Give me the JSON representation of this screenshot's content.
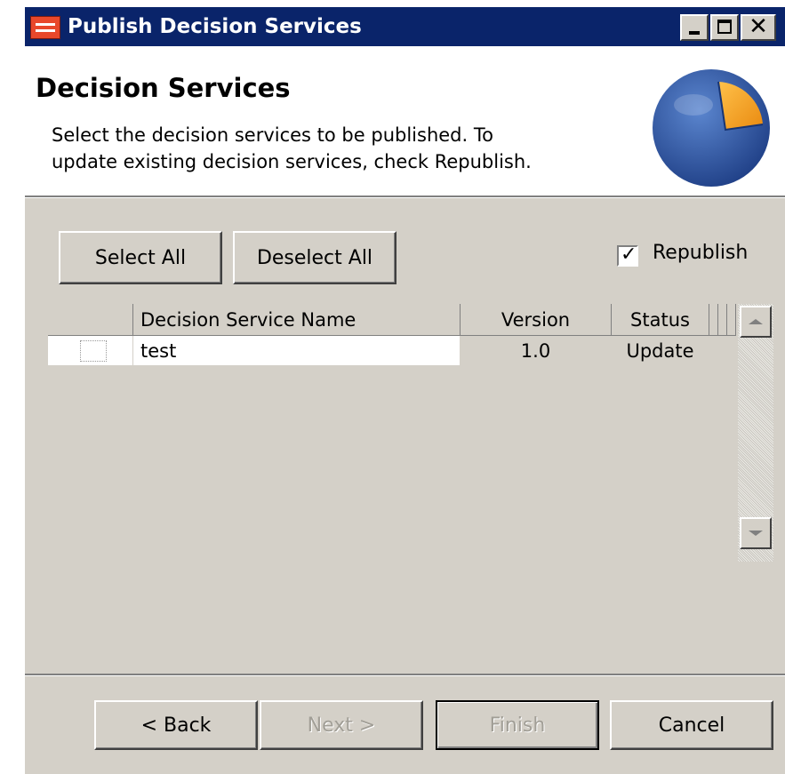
{
  "window": {
    "title": "Publish Decision Services",
    "controls": {
      "minimize": "minimize-icon",
      "maximize": "maximize-icon",
      "close": "close-icon"
    }
  },
  "header": {
    "title": "Decision Services",
    "description_line1": "Select the decision services to be published.  To",
    "description_line2": "update existing decision services, check Republish."
  },
  "toolbar": {
    "select_all_label": "Select All",
    "deselect_all_label": "Deselect All",
    "republish_label": "Republish",
    "republish_checked": true
  },
  "table": {
    "columns": [
      "",
      "Decision Service Name",
      "Version",
      "Status"
    ],
    "rows": [
      {
        "checked": false,
        "name": "test",
        "version": "1.0",
        "status": "Update"
      }
    ]
  },
  "footer": {
    "back_label": "< Back",
    "next_label": "Next >",
    "finish_label": "Finish",
    "cancel_label": "Cancel",
    "next_enabled": false,
    "finish_enabled": false
  },
  "colors": {
    "titlebar": "#0a246a",
    "dialog_face": "#d4d0c8",
    "logo_blue": "#2e5aa8",
    "logo_orange": "#f2a21a"
  }
}
